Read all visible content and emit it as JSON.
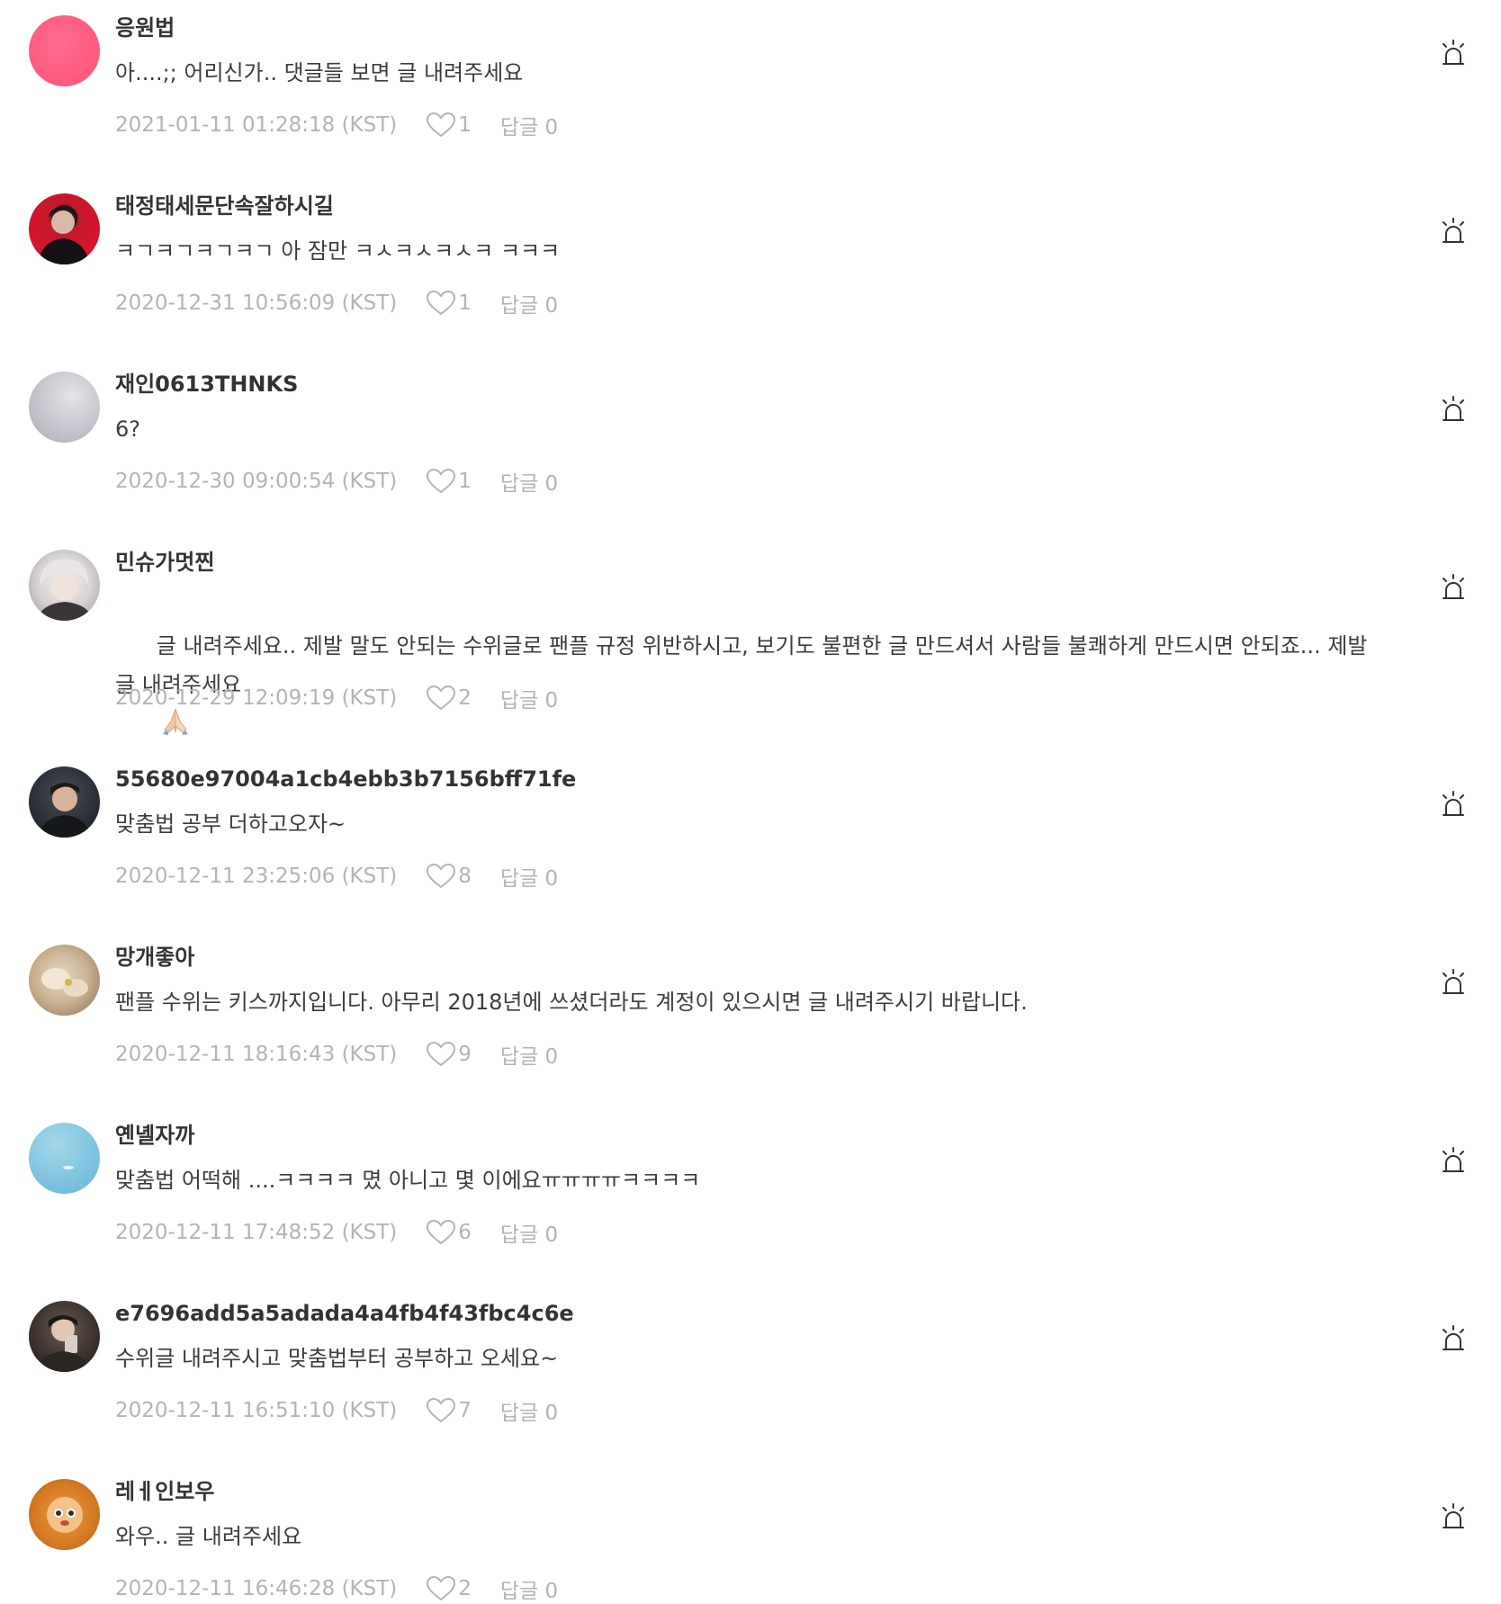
{
  "colors": {
    "meta_text": "#b3b3b9",
    "username_text": "#333333",
    "body_text": "#3d3d3d",
    "icon_stroke": "#333333"
  },
  "comments": [
    {
      "username": "응원법",
      "text": "아....;; 어리신가.. 댓글들 보면 글 내려주세요",
      "date": "2021-01-11 01:28:18 (KST)",
      "likes": "1",
      "reply_label": "답글",
      "reply_count": "0",
      "avatar_icon": "pink-circle-avatar"
    },
    {
      "username": "태정태세문단속잘하시길",
      "text": "ㅋㄱㅋㄱㅋㄱㅋㄱ 아 잠만 ㅋㅅㅋㅅㅋㅅㅋ ㅋㅋㅋ",
      "date": "2020-12-31 10:56:09 (KST)",
      "likes": "1",
      "reply_label": "답글",
      "reply_count": "0",
      "avatar_icon": "portrait-red-background-avatar"
    },
    {
      "username": "재인0613THNKS",
      "text": "6?",
      "date": "2020-12-30 09:00:54 (KST)",
      "likes": "1",
      "reply_label": "답글",
      "reply_count": "0",
      "avatar_icon": "grey-gradient-avatar"
    },
    {
      "username": "민슈가멋찐",
      "text": "글 내려주세요.. 제발 말도 안되는 수위글로 팬플 규정 위반하시고, 보기도 불편한 글 만드셔서 사람들 불쾌하게 만드시면 안되죠... 제발 글 내려주세요",
      "text_emoji": "folded-hands-emoji",
      "date": "2020-12-29 12:09:19 (KST)",
      "likes": "2",
      "reply_label": "답글",
      "reply_count": "0",
      "avatar_icon": "portrait-light-hair-avatar"
    },
    {
      "username": "55680e97004a1cb4ebb3b7156bff71fe",
      "text": "맞춤법 공부 더하고오자~",
      "date": "2020-12-11 23:25:06 (KST)",
      "likes": "8",
      "reply_label": "답글",
      "reply_count": "0",
      "avatar_icon": "portrait-dark-background-avatar"
    },
    {
      "username": "망개좋아",
      "text": "팬플 수위는 키스까지입니다. 아무리 2018년에 쓰셨더라도 계정이 있으시면 글 내려주시기 바랍니다.",
      "date": "2020-12-11 18:16:43 (KST)",
      "likes": "9",
      "reply_label": "답글",
      "reply_count": "0",
      "avatar_icon": "plush-toy-avatar"
    },
    {
      "username": "옌녤자까",
      "text": "맞춤법 어떡해 ....ㅋㅋㅋㅋ 몄 아니고 몇 이에요ㅠㅠㅠㅠㅋㅋㅋㅋ",
      "date": "2020-12-11 17:48:52 (KST)",
      "likes": "6",
      "reply_label": "답글",
      "reply_count": "0",
      "avatar_icon": "sky-avatar"
    },
    {
      "username": "e7696add5a5adada4a4fb4f43fbc4c6e",
      "text": "수위글 내려주시고 맞춤법부터 공부하고 오세요~",
      "date": "2020-12-11 16:51:10 (KST)",
      "likes": "7",
      "reply_label": "답글",
      "reply_count": "0",
      "avatar_icon": "portrait-phone-avatar"
    },
    {
      "username": "레ㅔ인보우",
      "text": "와우.. 글 내려주세요",
      "date": "2020-12-11 16:46:28 (KST)",
      "likes": "2",
      "reply_label": "답글",
      "reply_count": "0",
      "avatar_icon": "doll-avatar"
    }
  ]
}
